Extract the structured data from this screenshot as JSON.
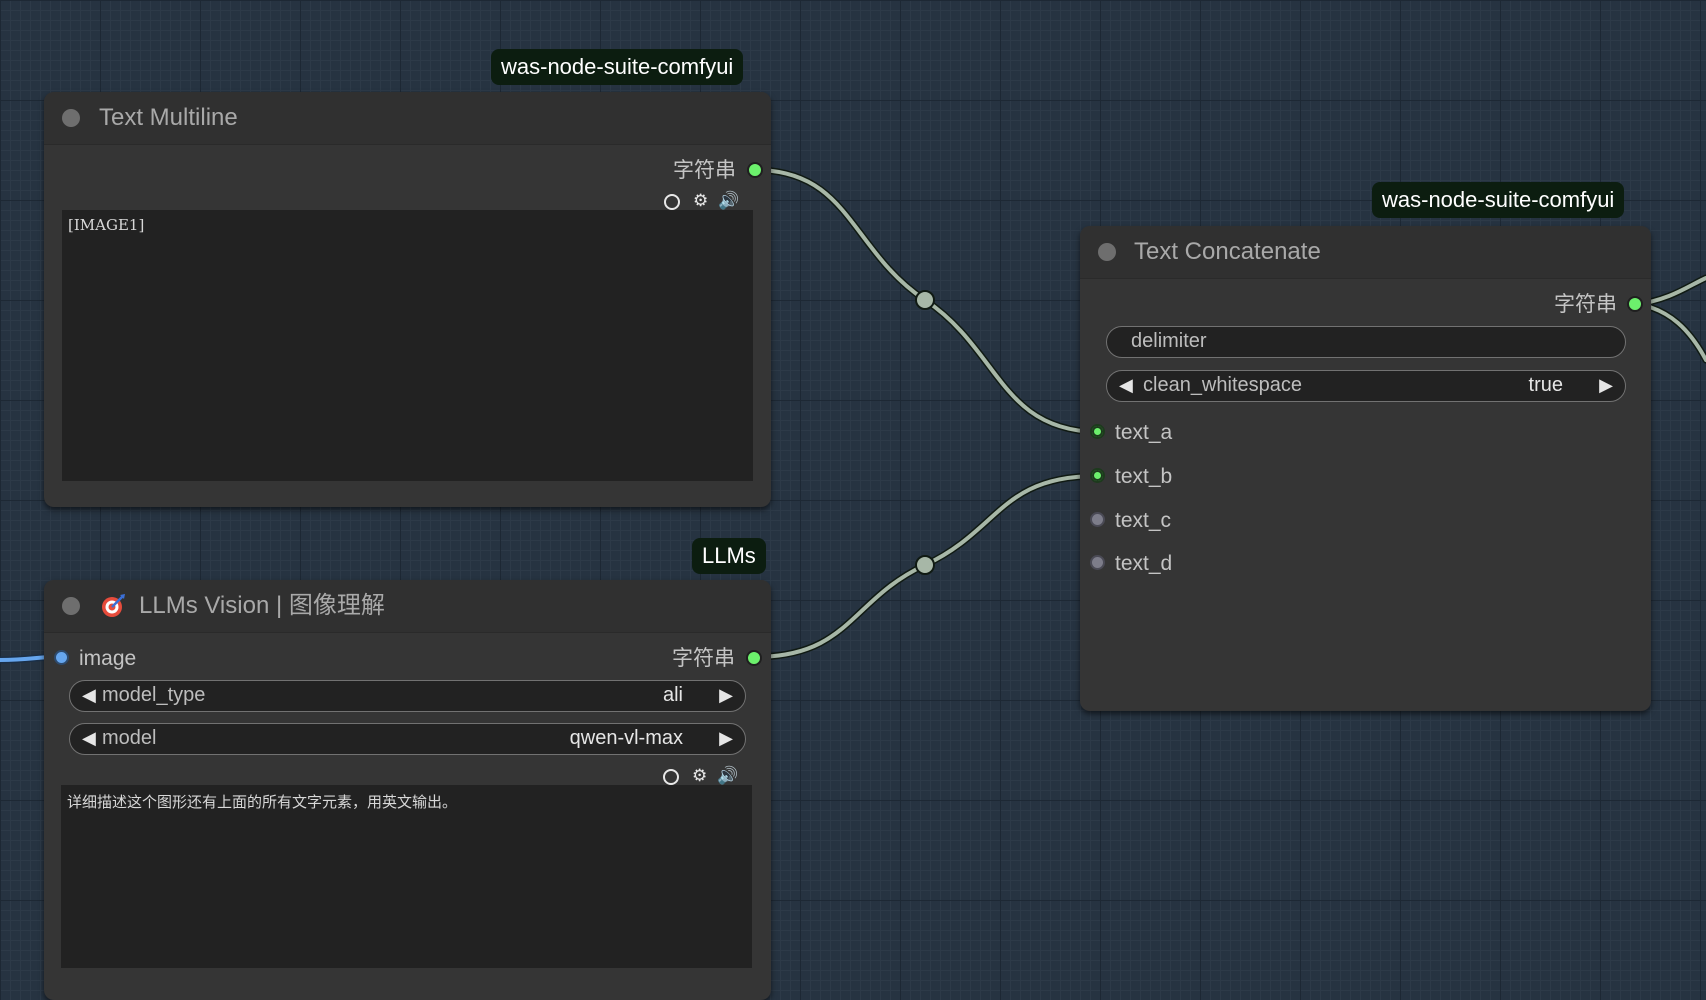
{
  "nodes": {
    "text_multiline": {
      "badge": "was-node-suite-comfyui",
      "title": "Text Multiline",
      "output_label": "字符串",
      "text": "[IMAGE1]"
    },
    "llms_vision": {
      "badge": "LLMs",
      "title": "LLMs Vision | 图像理解",
      "input_label": "image",
      "output_label": "字符串",
      "widgets": [
        {
          "label": "model_type",
          "value": "ali"
        },
        {
          "label": "model",
          "value": "qwen-vl-max"
        }
      ],
      "prompt": "详细描述这个图形还有上面的所有文字元素，用英文输出。"
    },
    "text_concatenate": {
      "badge": "was-node-suite-comfyui",
      "title": "Text Concatenate",
      "output_label": "字符串",
      "delimiter_label": "delimiter",
      "toggle": {
        "label": "clean_whitespace",
        "value": "true"
      },
      "inputs": [
        {
          "label": "text_a",
          "connected": true
        },
        {
          "label": "text_b",
          "connected": true
        },
        {
          "label": "text_c",
          "connected": false
        },
        {
          "label": "text_d",
          "connected": false
        }
      ]
    }
  },
  "colors": {
    "canvas": "#263341",
    "node_body": "#353535",
    "node_title": "#303030",
    "string_link": "#a7b7a7",
    "image_link": "#66a6ee",
    "output_slot": "#6cf06c",
    "badge_bg": "#0c1d10"
  }
}
